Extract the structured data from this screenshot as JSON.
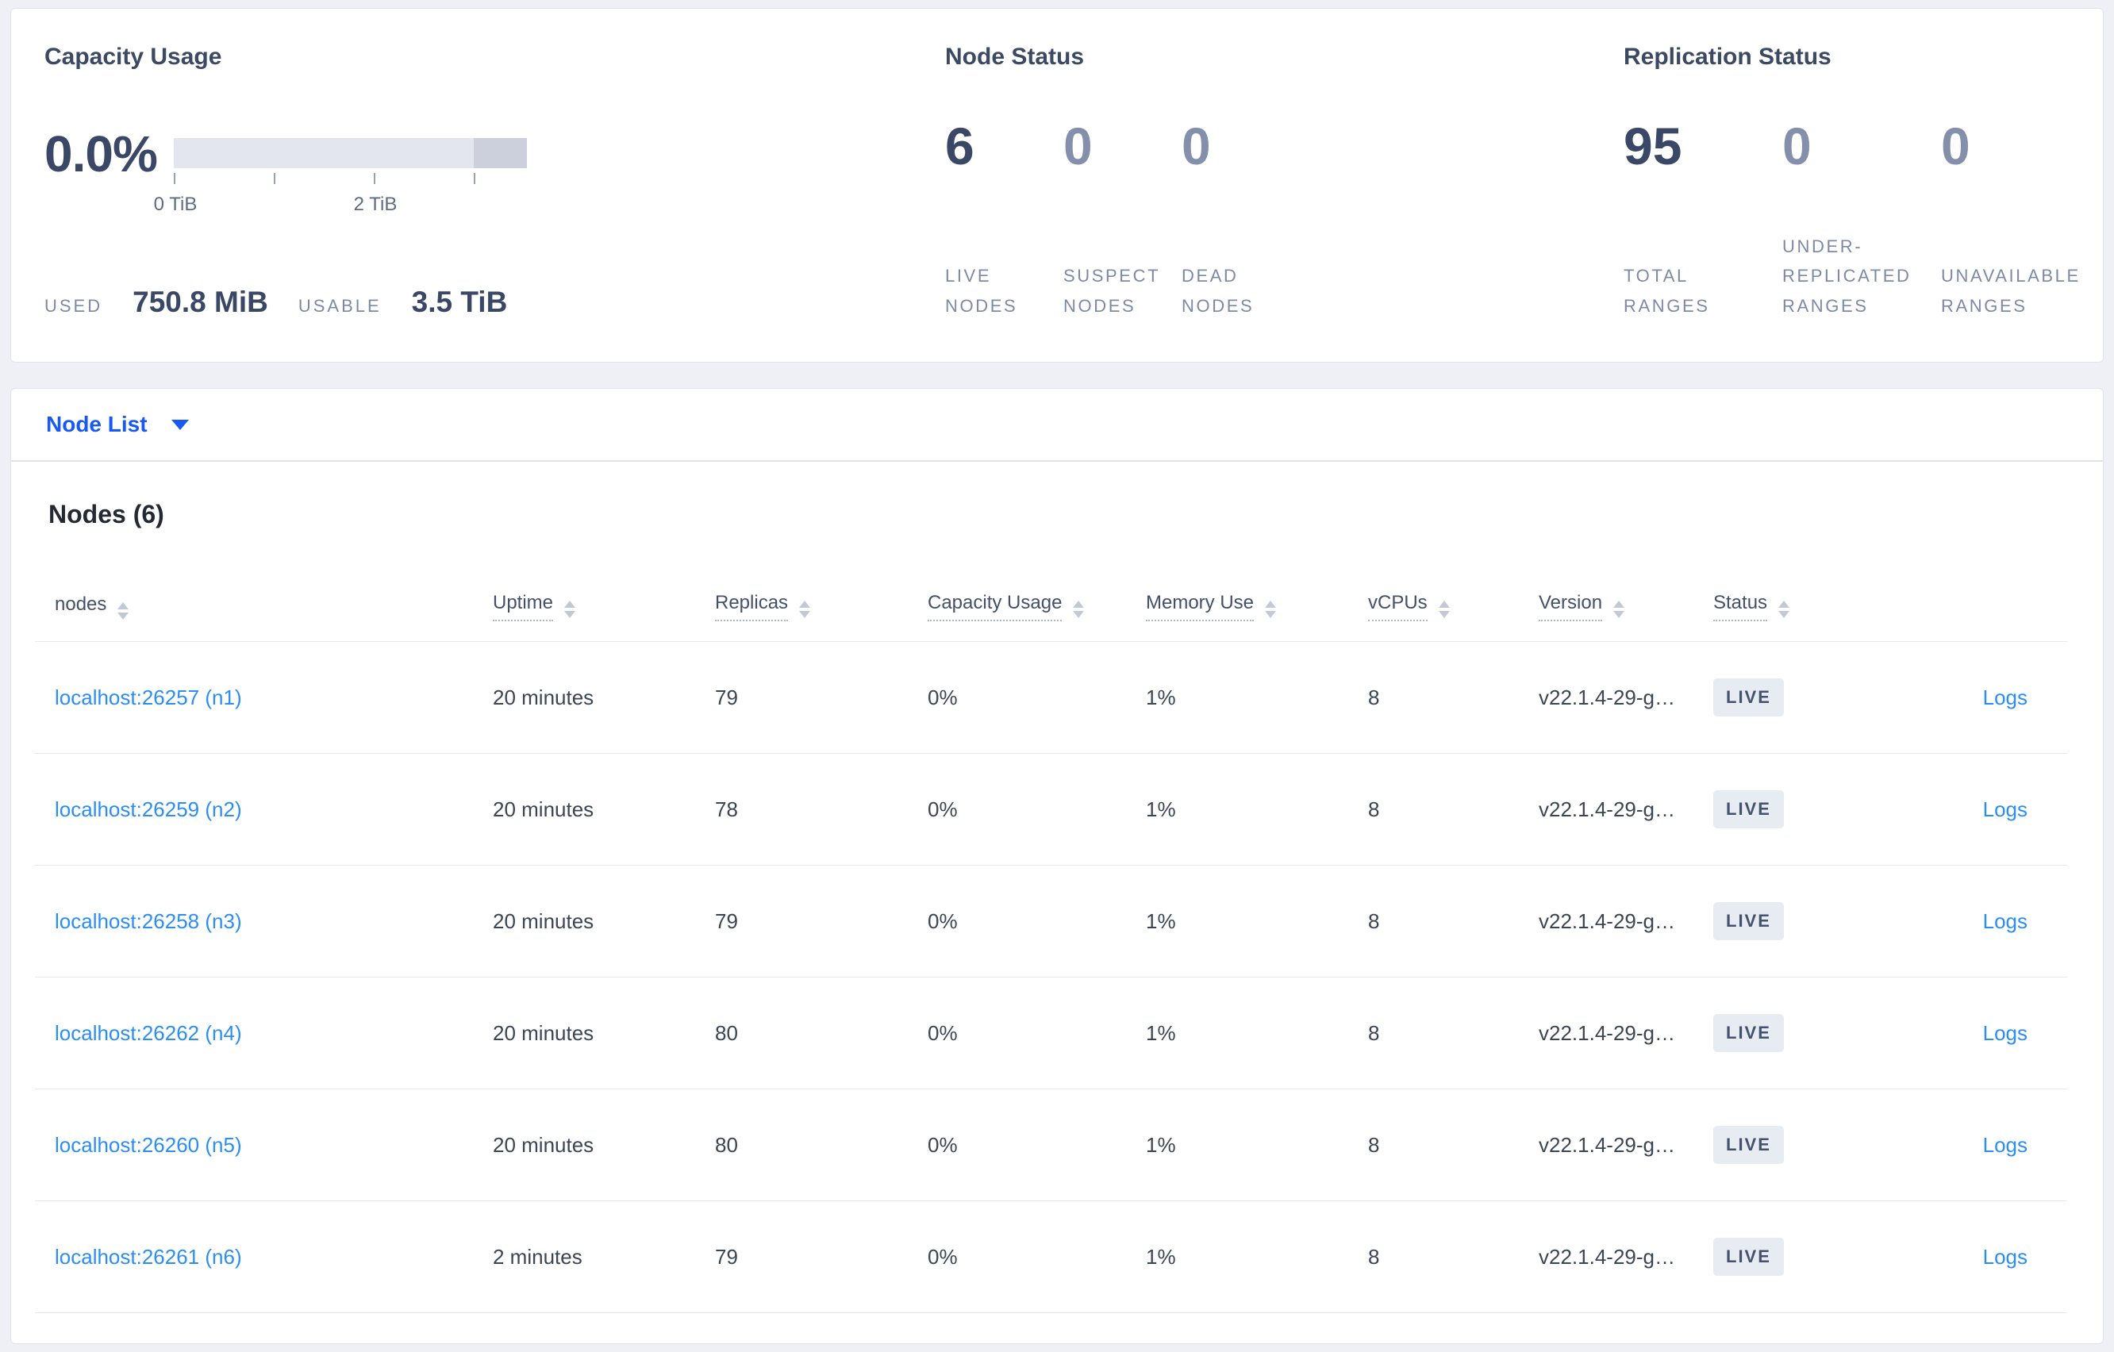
{
  "colors": {
    "page_bg": "#eef0f5",
    "panel_bg": "#ffffff",
    "accent_blue": "#1759f2",
    "link_blue": "#2b8ef5",
    "dark_text": "#3a4766",
    "muted_text": "#7d89a6",
    "badge_bg": "#e7ebf2",
    "bar_light": "#e4e6ef",
    "bar_dark": "#ccd0dc",
    "divider": "#e6e9ef"
  },
  "icons": {
    "sort": "sort-arrows-icon",
    "dropdown": "chevron-down-icon"
  },
  "summary": {
    "capacity": {
      "title": "Capacity Usage",
      "used_percent": "0.0%",
      "bar": {
        "type": "gauge",
        "total_tib": 3.5,
        "used_fraction": 0.0,
        "segments": [
          {
            "name": "usable",
            "fraction": 0.849,
            "color": "#e4e6ef"
          },
          {
            "name": "other",
            "fraction": 0.151,
            "color": "#ccd0dc"
          }
        ],
        "tick_fractions": [
          0,
          0.283,
          0.566,
          0.849
        ]
      },
      "axis_labels": {
        "0": "0 TiB",
        "1": "2 TiB"
      },
      "used_label": "USED",
      "used_value": "750.8 MiB",
      "usable_label": "USABLE",
      "usable_value": "3.5 TiB"
    },
    "node_status": {
      "title": "Node Status",
      "stats": [
        {
          "value": "6",
          "label": "LIVE NODES"
        },
        {
          "value": "0",
          "label": "SUSPECT NODES"
        },
        {
          "value": "0",
          "label": "DEAD NODES"
        }
      ]
    },
    "replication": {
      "title": "Replication Status",
      "stats": [
        {
          "value": "95",
          "label": "TOTAL RANGES"
        },
        {
          "value": "0",
          "label": "UNDER-REPLICATED RANGES"
        },
        {
          "value": "0",
          "label": "UNAVAILABLE RANGES"
        }
      ]
    }
  },
  "view_selector": {
    "label": "Node List"
  },
  "table": {
    "title": "Nodes (6)",
    "columns": [
      {
        "label": "nodes"
      },
      {
        "label": "Uptime"
      },
      {
        "label": "Replicas"
      },
      {
        "label": "Capacity Usage"
      },
      {
        "label": "Memory Use"
      },
      {
        "label": "vCPUs"
      },
      {
        "label": "Version"
      },
      {
        "label": "Status"
      }
    ],
    "rows": [
      {
        "node": "localhost:26257 (n1)",
        "uptime": "20 minutes",
        "replicas": "79",
        "capacity": "0%",
        "memory": "1%",
        "vcpus": "8",
        "version": "v22.1.4-29-g…",
        "status": "LIVE",
        "logs": "Logs"
      },
      {
        "node": "localhost:26259 (n2)",
        "uptime": "20 minutes",
        "replicas": "78",
        "capacity": "0%",
        "memory": "1%",
        "vcpus": "8",
        "version": "v22.1.4-29-g…",
        "status": "LIVE",
        "logs": "Logs"
      },
      {
        "node": "localhost:26258 (n3)",
        "uptime": "20 minutes",
        "replicas": "79",
        "capacity": "0%",
        "memory": "1%",
        "vcpus": "8",
        "version": "v22.1.4-29-g…",
        "status": "LIVE",
        "logs": "Logs"
      },
      {
        "node": "localhost:26262 (n4)",
        "uptime": "20 minutes",
        "replicas": "80",
        "capacity": "0%",
        "memory": "1%",
        "vcpus": "8",
        "version": "v22.1.4-29-g…",
        "status": "LIVE",
        "logs": "Logs"
      },
      {
        "node": "localhost:26260 (n5)",
        "uptime": "20 minutes",
        "replicas": "80",
        "capacity": "0%",
        "memory": "1%",
        "vcpus": "8",
        "version": "v22.1.4-29-g…",
        "status": "LIVE",
        "logs": "Logs"
      },
      {
        "node": "localhost:26261 (n6)",
        "uptime": "2 minutes",
        "replicas": "79",
        "capacity": "0%",
        "memory": "1%",
        "vcpus": "8",
        "version": "v22.1.4-29-g…",
        "status": "LIVE",
        "logs": "Logs"
      }
    ]
  }
}
